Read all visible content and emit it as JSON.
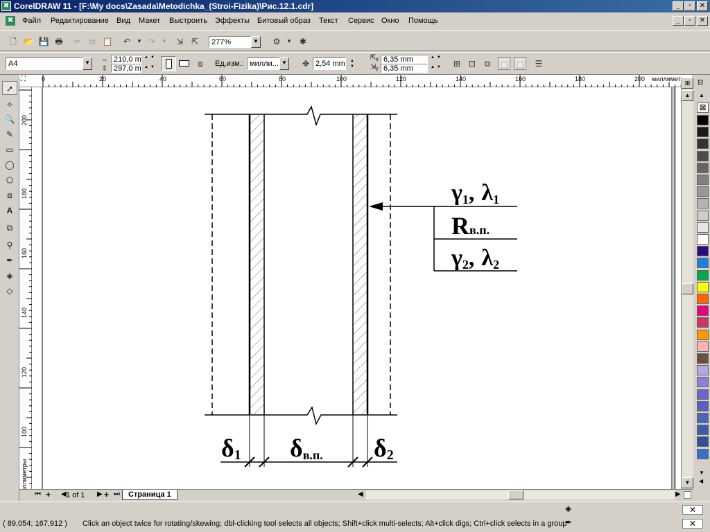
{
  "window": {
    "title": "CorelDRAW 11 - [F:\\My docs\\Zasada\\Metodichka_(Stroi-Fizika)\\Рис.12.1.cdr]",
    "min_glyph": "_",
    "max_glyph": "▫",
    "close_glyph": "✕"
  },
  "menu": {
    "items": [
      "Файл",
      "Редактирование",
      "Вид",
      "Макет",
      "Выстроить",
      "Эффекты",
      "Битовый образ",
      "Текст",
      "Сервис",
      "Окно",
      "Помощь"
    ]
  },
  "toolbar": {
    "zoom_value": "277%"
  },
  "property_bar": {
    "page_size": "A4",
    "width_value": "210,0 m",
    "height_value": "297,0 m",
    "units_label": "Ед.изм.:",
    "units_value": "милли...",
    "nudge_value": "2,54 mm",
    "dup_x_value": "6,35 mm",
    "dup_y_value": "6,35 mm",
    "dup_x_label": "x",
    "dup_y_label": "y"
  },
  "rulers": {
    "units": "миллиметры",
    "h_ticks": [
      "0",
      "20",
      "40",
      "60",
      "80",
      "100",
      "120",
      "140",
      "160",
      "180",
      "200"
    ],
    "v_ticks": [
      "200",
      "180",
      "160",
      "140",
      "120",
      "100"
    ]
  },
  "drawing": {
    "gamma1": "γ",
    "lambda1": "λ",
    "sub1": "1",
    "r_main": "R",
    "r_sub": "в.п.",
    "sub2": "2",
    "delta": "δ",
    "delta_vp_sub": "в.п.",
    "comma": ","
  },
  "page_nav": {
    "counter": "1 of 1",
    "tab_label": "Страница 1"
  },
  "status": {
    "coords": "( 89,054; 167,912 )",
    "hint": "Click an object twice for rotating/skewing; dbl-clicking tool selects all objects; Shift+click multi-selects; Alt+click digs; Ctrl+click selects in a group"
  },
  "palette": {
    "colors": [
      "#000000",
      "#1a1a1a",
      "#333333",
      "#4d4d4d",
      "#666666",
      "#808080",
      "#999999",
      "#b3b3b3",
      "#cccccc",
      "#e6e6e6",
      "#ffffff",
      "#2b0a80",
      "#1e7fd6",
      "#00a650",
      "#ffff00",
      "#ff6600",
      "#e6007e",
      "#cc3366",
      "#ff9900",
      "#ffb3b3",
      "#6b4f3a",
      "#b3a6e6",
      "#8c7fd9",
      "#6666cc",
      "#5a5fbf",
      "#4d63b3",
      "#405aa6",
      "#334d99",
      "#3a6fd0"
    ]
  }
}
